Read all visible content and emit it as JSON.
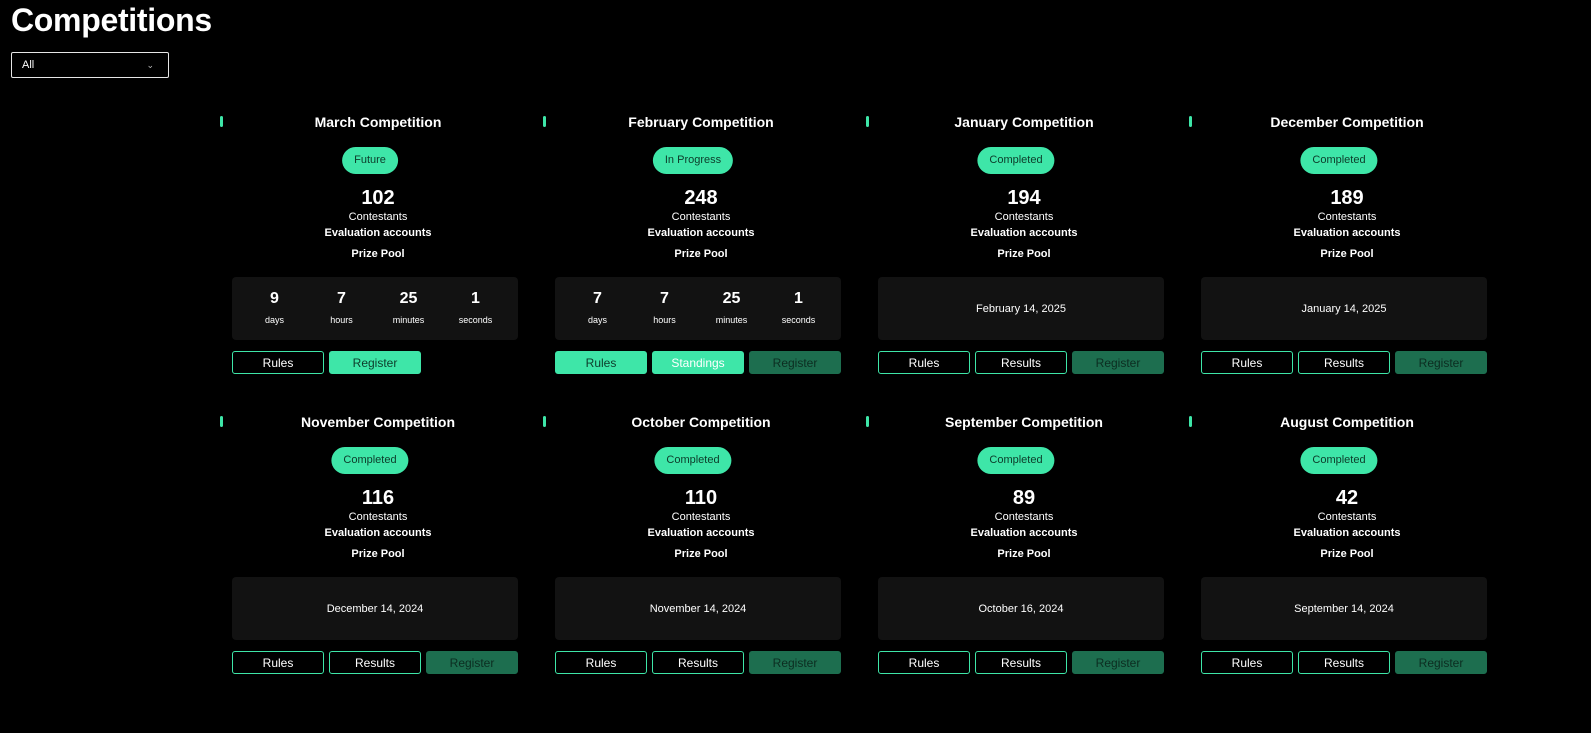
{
  "page": {
    "title": "Competitions"
  },
  "filter": {
    "value": "All"
  },
  "colors": {
    "accent": "#3ee6a8",
    "disabled_button": "#1d6e4f",
    "panel": "#121212",
    "background": "#000000"
  },
  "labels": {
    "contestants": "Contestants",
    "evaluation_accounts": "Evaluation accounts",
    "prize_pool": "Prize Pool"
  },
  "competitions": [
    {
      "title": "March Competition",
      "status": "Future",
      "contestants": "102",
      "countdown": {
        "days": "9",
        "hours": "7",
        "minutes": "25",
        "seconds": "1",
        "labels": {
          "days": "days",
          "hours": "hours",
          "minutes": "minutes",
          "seconds": "seconds"
        }
      },
      "date": "",
      "buttons": [
        {
          "label": "Rules",
          "style": "outline"
        },
        {
          "label": "Register",
          "style": "filled"
        }
      ]
    },
    {
      "title": "February Competition",
      "status": "In Progress",
      "contestants": "248",
      "countdown": {
        "days": "7",
        "hours": "7",
        "minutes": "25",
        "seconds": "1",
        "labels": {
          "days": "days",
          "hours": "hours",
          "minutes": "minutes",
          "seconds": "seconds"
        }
      },
      "date": "",
      "buttons": [
        {
          "label": "Rules",
          "style": "filled"
        },
        {
          "label": "Standings",
          "style": "filled-light"
        },
        {
          "label": "Register",
          "style": "disabled"
        }
      ]
    },
    {
      "title": "January Competition",
      "status": "Completed",
      "contestants": "194",
      "date": "February 14, 2025",
      "buttons": [
        {
          "label": "Rules",
          "style": "outline"
        },
        {
          "label": "Results",
          "style": "outline"
        },
        {
          "label": "Register",
          "style": "disabled"
        }
      ]
    },
    {
      "title": "December Competition",
      "status": "Completed",
      "contestants": "189",
      "date": "January 14, 2025",
      "buttons": [
        {
          "label": "Rules",
          "style": "outline"
        },
        {
          "label": "Results",
          "style": "outline"
        },
        {
          "label": "Register",
          "style": "disabled"
        }
      ]
    },
    {
      "title": "November Competition",
      "status": "Completed",
      "contestants": "116",
      "date": "December 14, 2024",
      "buttons": [
        {
          "label": "Rules",
          "style": "outline"
        },
        {
          "label": "Results",
          "style": "outline"
        },
        {
          "label": "Register",
          "style": "disabled"
        }
      ]
    },
    {
      "title": "October Competition",
      "status": "Completed",
      "contestants": "110",
      "date": "November 14, 2024",
      "buttons": [
        {
          "label": "Rules",
          "style": "outline"
        },
        {
          "label": "Results",
          "style": "outline"
        },
        {
          "label": "Register",
          "style": "disabled"
        }
      ]
    },
    {
      "title": "September Competition",
      "status": "Completed",
      "contestants": "89",
      "date": "October 16, 2024",
      "buttons": [
        {
          "label": "Rules",
          "style": "outline"
        },
        {
          "label": "Results",
          "style": "outline"
        },
        {
          "label": "Register",
          "style": "disabled"
        }
      ]
    },
    {
      "title": "August Competition",
      "status": "Completed",
      "contestants": "42",
      "date": "September 14, 2024",
      "buttons": [
        {
          "label": "Rules",
          "style": "outline"
        },
        {
          "label": "Results",
          "style": "outline"
        },
        {
          "label": "Register",
          "style": "disabled"
        }
      ]
    }
  ]
}
